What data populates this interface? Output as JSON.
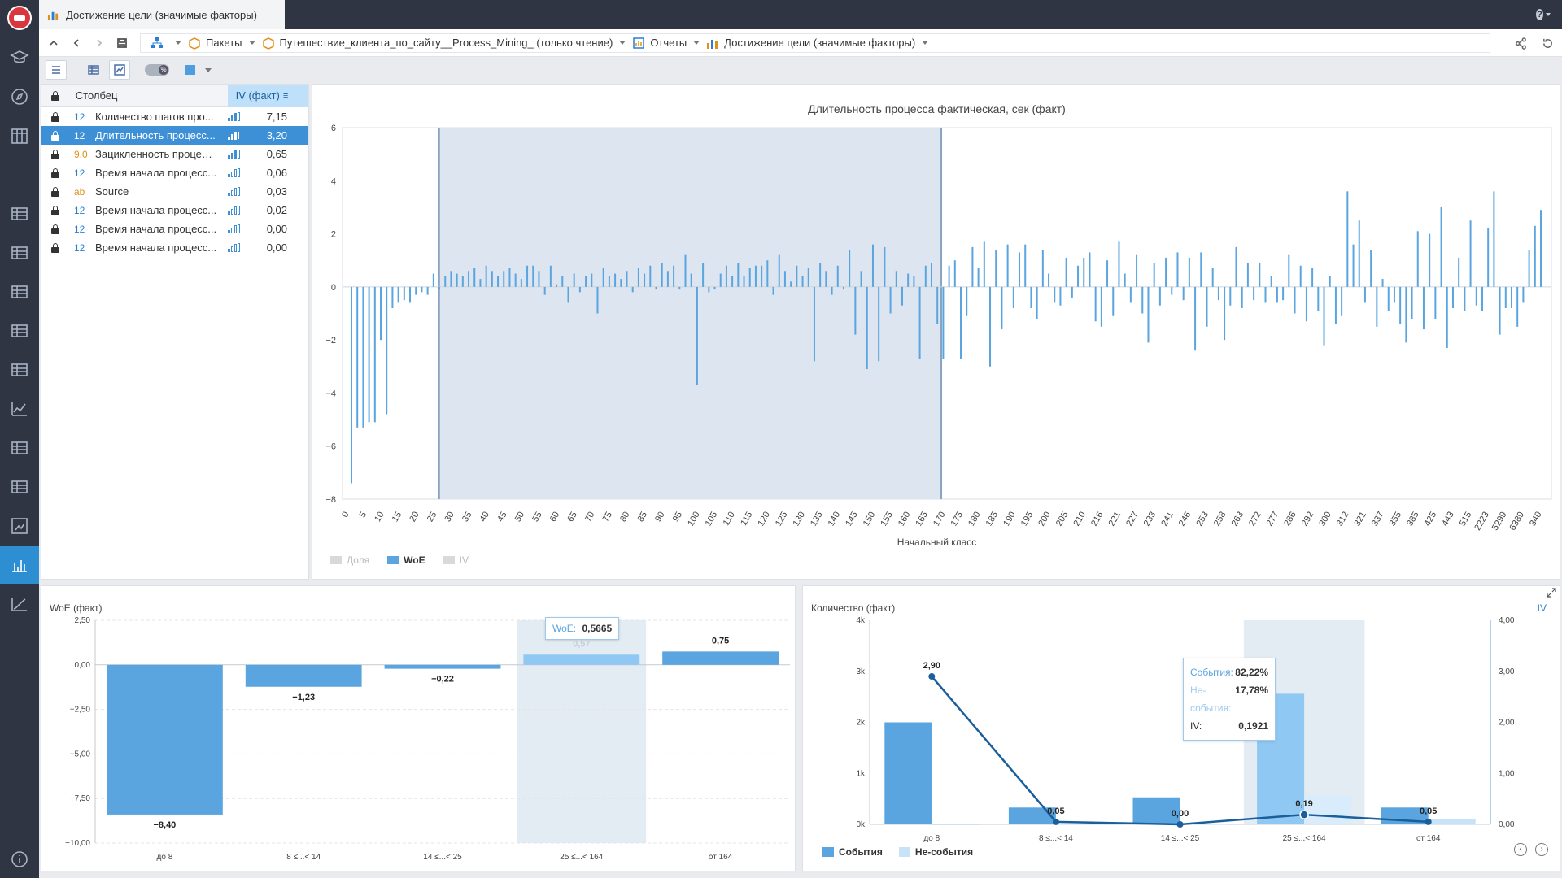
{
  "window": {
    "tab_title": "Достижение цели (значимые факторы)"
  },
  "breadcrumb": {
    "packages": "Пакеты",
    "project": "Путешествие_клиента_по_сайту__Process_Mining_ (только чтение)",
    "reports": "Отчеты",
    "report": "Достижение цели (значимые факторы)"
  },
  "list": {
    "header_column": "Столбец",
    "header_iv": "IV (факт)",
    "rows": [
      {
        "type": "12",
        "name": "Количество шагов про...",
        "value": "7,15",
        "strength": 3
      },
      {
        "type": "12",
        "name": "Длительность процесс...",
        "value": "3,20",
        "strength": 3,
        "selected": true
      },
      {
        "type": "9.0",
        "name": "Зацикленность процесса",
        "value": "0,65",
        "strength": 3
      },
      {
        "type": "12",
        "name": "Время начала процесс...",
        "value": "0,06",
        "strength": 1
      },
      {
        "type": "ab",
        "name": "Source",
        "value": "0,03",
        "strength": 1
      },
      {
        "type": "12",
        "name": "Время начала процесс...",
        "value": "0,02",
        "strength": 1
      },
      {
        "type": "12",
        "name": "Время начала процесс...",
        "value": "0,00",
        "strength": 0
      },
      {
        "type": "12",
        "name": "Время начала процесс...",
        "value": "0,00",
        "strength": 0
      }
    ]
  },
  "top_chart": {
    "title": "Длительность процесса фактическая, сек (факт)",
    "xlabel": "Начальный класс",
    "legend": [
      {
        "label": "Доля",
        "color": "#cccccc",
        "active": false
      },
      {
        "label": "WoE",
        "color": "#5aa5e0",
        "active": true
      },
      {
        "label": "IV",
        "color": "#cccccc",
        "active": false
      }
    ]
  },
  "woe_chart": {
    "title": "WoE (факт)",
    "tooltip": {
      "label": "WoE:",
      "value": "0,5665"
    }
  },
  "count_chart": {
    "title": "Количество (факт)",
    "iv_axis": "IV",
    "tooltip": {
      "events_label": "События:",
      "events_value": "82,22%",
      "nonevents_label": "Не-события:",
      "nonevents_value": "17,78%",
      "iv_label": "IV:",
      "iv_value": "0,1921"
    },
    "legend": [
      {
        "label": "События",
        "color": "#5aa5e0"
      },
      {
        "label": "Не-события",
        "color": "#c7e3fa"
      }
    ]
  },
  "chart_data": [
    {
      "type": "bar",
      "title": "Длительность процесса фактическая, сек (факт)",
      "xlabel": "Начальный класс",
      "ylabel": "",
      "ylim": [
        -8,
        6
      ],
      "yticks": [
        6,
        4,
        2,
        0,
        -2,
        -4,
        -6,
        -8
      ],
      "xtick_labels": [
        "0",
        "5",
        "10",
        "15",
        "20",
        "25",
        "30",
        "35",
        "40",
        "45",
        "50",
        "55",
        "60",
        "65",
        "70",
        "75",
        "80",
        "85",
        "90",
        "95",
        "100",
        "105",
        "110",
        "115",
        "120",
        "125",
        "130",
        "135",
        "140",
        "145",
        "150",
        "155",
        "160",
        "165",
        "170",
        "175",
        "180",
        "185",
        "190",
        "195",
        "200",
        "205",
        "210",
        "216",
        "221",
        "227",
        "233",
        "241",
        "246",
        "253",
        "258",
        "263",
        "272",
        "277",
        "286",
        "292",
        "300",
        "312",
        "321",
        "337",
        "355",
        "385",
        "425",
        "443",
        "515",
        "2223",
        "5299",
        "6389",
        "340"
      ],
      "selected_range": [
        "25",
        "164"
      ],
      "series": [
        {
          "name": "WoE",
          "color": "#5aa5e0",
          "values": [
            -7.4,
            -5.3,
            -5.3,
            -5.1,
            -5.1,
            -2.0,
            -4.8,
            -0.8,
            -0.6,
            -0.5,
            -0.6,
            -0.3,
            -0.2,
            -0.3,
            0.5,
            -0.1,
            0.4,
            0.6,
            0.5,
            0.4,
            0.6,
            0.7,
            0.3,
            0.8,
            0.6,
            0.4,
            0.6,
            0.7,
            0.5,
            0.3,
            0.8,
            0.8,
            0.6,
            -0.3,
            0.8,
            0.1,
            0.4,
            -0.6,
            0.5,
            -0.2,
            0.4,
            0.5,
            -1.0,
            0.7,
            0.4,
            0.5,
            0.3,
            0.6,
            -0.2,
            0.7,
            0.5,
            0.8,
            -0.1,
            0.9,
            0.6,
            0.8,
            -0.1,
            1.2,
            0.5,
            -3.7,
            0.9,
            -0.2,
            -0.1,
            0.5,
            0.8,
            0.4,
            0.9,
            0.4,
            0.7,
            0.8,
            0.8,
            1.0,
            -0.3,
            1.2,
            0.6,
            0.2,
            0.8,
            0.4,
            0.7,
            -2.8,
            0.9,
            0.6,
            -0.3,
            0.8,
            -0.1,
            1.4,
            -1.8,
            0.6,
            -3.1,
            1.6,
            -2.8,
            1.5,
            -1.0,
            0.6,
            -0.7,
            0.5,
            0.4,
            -2.7,
            0.8,
            0.9,
            -1.4,
            -2.7,
            0.8,
            1.0,
            -2.7,
            -1.1,
            1.5,
            0.7,
            1.7,
            -3.0
          ],
          "values_right": [
            1.4,
            -1.6,
            1.6,
            -0.8,
            1.3,
            1.6,
            -0.8,
            -1.2,
            1.4,
            0.5,
            -0.6,
            -0.7,
            1.1,
            -0.4,
            0.8,
            1.1,
            1.3,
            -1.3,
            -1.5,
            1.0,
            -1.1,
            1.7,
            0.5,
            -0.6,
            1.2,
            -1.0,
            -2.1,
            0.9,
            -0.7,
            1.1,
            -0.3,
            1.3,
            -0.5,
            1.1,
            -2.4,
            1.3,
            -1.5,
            0.7,
            -0.5,
            -2.0,
            -0.7,
            1.5,
            -0.8,
            0.9,
            -0.5,
            0.9,
            -0.6,
            0.4,
            -0.6,
            -0.5,
            1.2,
            -1.0,
            0.8,
            -1.3,
            0.7,
            -0.9,
            -2.2,
            0.4,
            -1.4,
            -1.1,
            3.6,
            1.6,
            2.5,
            -0.6,
            1.4,
            -1.5,
            0.3,
            -0.9,
            -0.6,
            -1.4,
            -2.1,
            -1.2,
            2.1,
            -1.6,
            2.0,
            -1.2,
            3.0,
            -2.3,
            -0.8,
            1.1,
            -0.9,
            2.5,
            -0.7,
            -0.9,
            2.2,
            3.6,
            -1.8,
            -0.8,
            -0.8,
            -1.5,
            -0.6,
            1.4,
            2.3,
            2.9
          ],
          "_note": "omit"
        }
      ]
    },
    {
      "type": "bar",
      "title": "WoE (факт)",
      "categories": [
        "до 8",
        "8 ≤...< 14",
        "14 ≤...< 25",
        "25 ≤...< 164",
        "от 164"
      ],
      "values": [
        -8.4,
        -1.23,
        -0.22,
        0.57,
        0.75
      ],
      "data_labels": [
        "−8,40",
        "−1,23",
        "−0,22",
        "0,57",
        "0,75"
      ],
      "ylim": [
        -10,
        2.5
      ],
      "yticks": [
        "2,50",
        "0,00",
        "−2,50",
        "−5,00",
        "−7,50",
        "−10,00"
      ],
      "highlighted": "25 ≤...< 164"
    },
    {
      "type": "bar",
      "title": "Количество (факт)",
      "categories": [
        "до 8",
        "8 ≤...< 14",
        "14 ≤...< 25",
        "25 ≤...< 164",
        "от 164"
      ],
      "series": [
        {
          "name": "События",
          "values": [
            2000,
            330,
            530,
            2560,
            330
          ]
        },
        {
          "name": "Не-события",
          "values": [
            0,
            10,
            10,
            560,
            100
          ]
        },
        {
          "name": "IV",
          "values": [
            2.9,
            0.05,
            0.0,
            0.19,
            0.05
          ]
        }
      ],
      "iv_labels": [
        "2,90",
        "0,05",
        "0,00",
        "0,19",
        "0,05"
      ],
      "ylim": [
        0,
        4000
      ],
      "yticks": [
        "4k",
        "3k",
        "2k",
        "1k",
        "0k"
      ],
      "y2lim": [
        0,
        4
      ],
      "y2ticks": [
        "4,00",
        "3,00",
        "2,00",
        "1,00",
        "0,00"
      ],
      "highlighted": "25 ≤...< 164"
    }
  ]
}
